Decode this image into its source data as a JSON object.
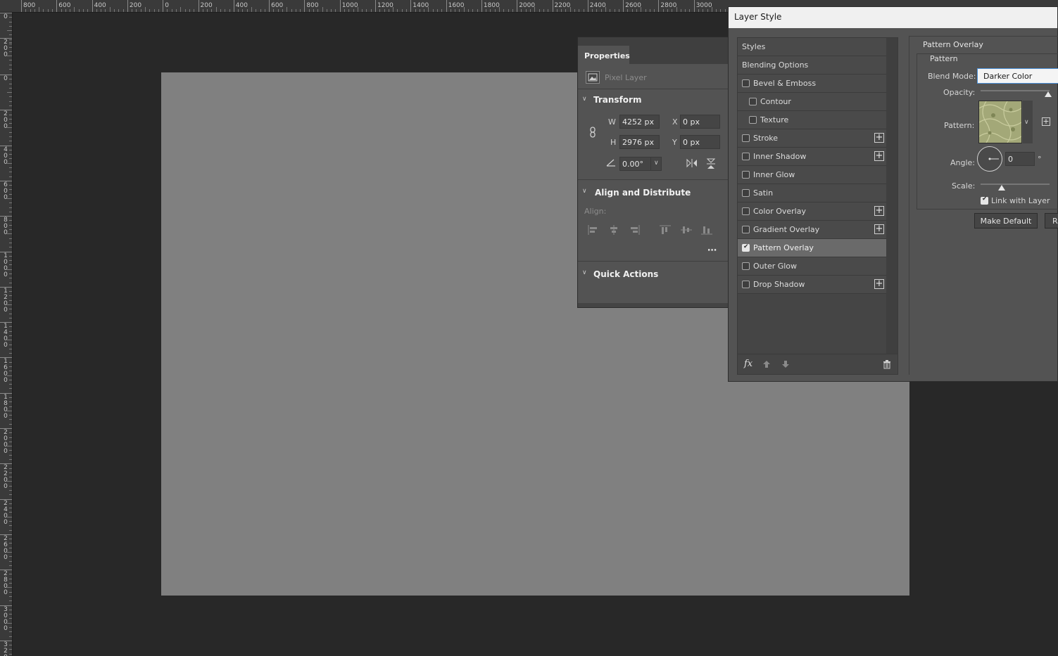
{
  "rulers": {
    "top_labels": [
      "800",
      "600",
      "400",
      "200",
      "0",
      "200",
      "400",
      "600",
      "800",
      "1000",
      "1200",
      "1400",
      "1600",
      "1800",
      "2000",
      "2200",
      "2400",
      "2600",
      "2800",
      "3000"
    ],
    "left_labels": [
      "0",
      "200",
      "0",
      "200",
      "400",
      "600",
      "800",
      "1000",
      "1200",
      "1400",
      "1600",
      "1800",
      "2000",
      "2200",
      "2400",
      "2600",
      "2800",
      "3000",
      "3200"
    ]
  },
  "properties": {
    "tab_label": "Properties",
    "layer_type": "Pixel Layer",
    "transform": {
      "heading": "Transform",
      "w_label": "W",
      "w_value": "4252 px",
      "h_label": "H",
      "h_value": "2976 px",
      "x_label": "X",
      "x_value": "0 px",
      "y_label": "Y",
      "y_value": "0 px",
      "angle_value": "0.00°"
    },
    "align": {
      "heading": "Align and Distribute",
      "label": "Align:"
    },
    "quick_actions": {
      "heading": "Quick Actions"
    }
  },
  "layer_style": {
    "title": "Layer Style",
    "styles": [
      {
        "label": "Styles",
        "type": "header"
      },
      {
        "label": "Blending Options",
        "type": "header"
      },
      {
        "label": "Bevel & Emboss",
        "checked": false,
        "plus": false,
        "indent": 0
      },
      {
        "label": "Contour",
        "checked": false,
        "plus": false,
        "indent": 1
      },
      {
        "label": "Texture",
        "checked": false,
        "plus": false,
        "indent": 1
      },
      {
        "label": "Stroke",
        "checked": false,
        "plus": true,
        "indent": 0
      },
      {
        "label": "Inner Shadow",
        "checked": false,
        "plus": true,
        "indent": 0
      },
      {
        "label": "Inner Glow",
        "checked": false,
        "plus": false,
        "indent": 0
      },
      {
        "label": "Satin",
        "checked": false,
        "plus": false,
        "indent": 0
      },
      {
        "label": "Color Overlay",
        "checked": false,
        "plus": true,
        "indent": 0
      },
      {
        "label": "Gradient Overlay",
        "checked": false,
        "plus": true,
        "indent": 0
      },
      {
        "label": "Pattern Overlay",
        "checked": true,
        "plus": false,
        "indent": 0,
        "selected": true
      },
      {
        "label": "Outer Glow",
        "checked": false,
        "plus": false,
        "indent": 0
      },
      {
        "label": "Drop Shadow",
        "checked": false,
        "plus": true,
        "indent": 0
      }
    ],
    "pattern_overlay": {
      "section_title": "Pattern Overlay",
      "group_title": "Pattern",
      "blend_mode_label": "Blend Mode:",
      "blend_mode_value": "Darker Color",
      "opacity_label": "Opacity:",
      "pattern_label": "Pattern:",
      "angle_label": "Angle:",
      "angle_value": "0",
      "degree_symbol": "°",
      "scale_label": "Scale:",
      "link_with_layer_label": "Link with Layer",
      "link_with_layer_checked": true,
      "make_default_label": "Make Default",
      "reset_default_label": "R"
    },
    "colors": {
      "pattern_swatch": "#a3a878"
    }
  }
}
